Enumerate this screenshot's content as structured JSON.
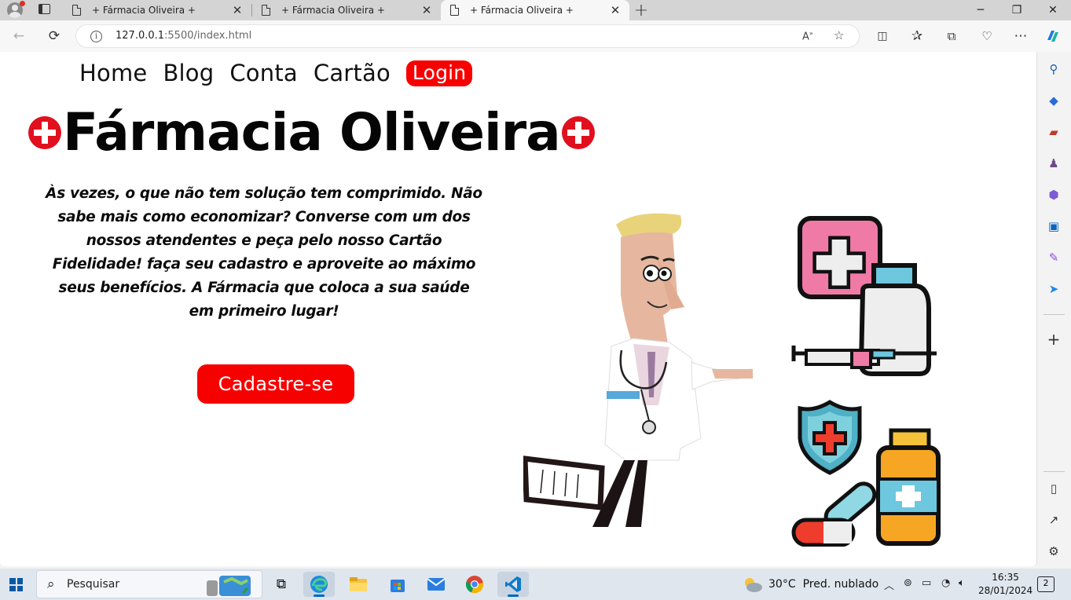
{
  "browser": {
    "tabs": [
      {
        "title": "+ Fármacia Oliveira +",
        "active": false
      },
      {
        "title": "+ Fármacia Oliveira +",
        "active": false
      },
      {
        "title": "+ Fármacia Oliveira +",
        "active": true
      }
    ],
    "new_tab_glyph": "+",
    "close_glyph": "✕",
    "url_host": "127.0.0.1",
    "url_rest": ":5500/index.html"
  },
  "page": {
    "nav": {
      "home": "Home",
      "blog": "Blog",
      "conta": "Conta",
      "cartao": "Cartão",
      "login": "Login"
    },
    "brand_title": "Fármacia Oliveira",
    "tagline": "Às vezes, o que não tem solução tem comprimido. Não sabe mais como economizar? Converse com um dos nossos atendentes e peça pelo nosso Cartão Fidelidade! faça seu cadastro e aproveite ao máximo seus benefícios. A Fármacia que coloca a sua saúde em primeiro lugar!",
    "cta_label": "Cadastre-se",
    "accent_color": "#f70000"
  },
  "taskbar": {
    "search_placeholder": "Pesquisar",
    "weather_temp": "30°C",
    "weather_desc": "Pred. nublado",
    "time": "16:35",
    "date": "28/01/2024",
    "notifications": "2"
  }
}
